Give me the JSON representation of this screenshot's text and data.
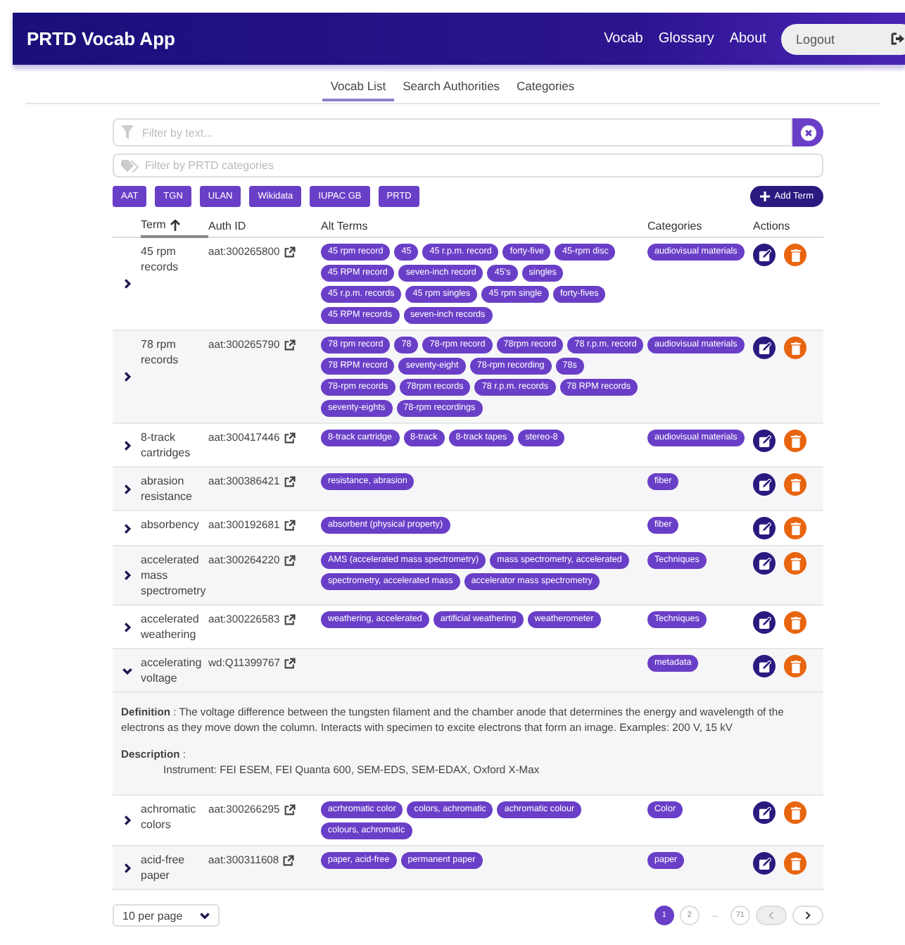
{
  "app_bar": {
    "title": "PRTD Vocab App",
    "nav": [
      "Vocab",
      "Glossary",
      "About"
    ],
    "logout": "Logout"
  },
  "tabs": [
    {
      "label": "Vocab List",
      "selected": true
    },
    {
      "label": "Search Authorities",
      "selected": false
    },
    {
      "label": "Categories",
      "selected": false
    }
  ],
  "text_filter": {
    "placeholder": "Filter by text..."
  },
  "category_filter": {
    "placeholder": "Filter by PRTD categories"
  },
  "sources": [
    "AAT",
    "TGN",
    "ULAN",
    "Wikidata",
    "IUPAC GB",
    "PRTD"
  ],
  "add_button": "Add Term",
  "table": {
    "columns": [
      "Term",
      "Auth ID",
      "Alt Terms",
      "Categories",
      "Actions"
    ],
    "rows": [
      {
        "term": "45 rpm records",
        "auth_id": "aat:300265800",
        "alt_terms": [
          "45 rpm record",
          "45",
          "45 r.p.m. record",
          "forty-five",
          "45-rpm disc",
          "45 RPM record",
          "seven-inch record",
          "45's",
          "singles",
          "45 r.p.m. records",
          "45 rpm singles",
          "45 rpm single",
          "forty-fives",
          "45 RPM records",
          "seven-inch records"
        ],
        "categories": [
          "audiovisual materials"
        ],
        "expanded": false
      },
      {
        "term": "78 rpm records",
        "auth_id": "aat:300265790",
        "alt_terms": [
          "78 rpm record",
          "78",
          "78-rpm record",
          "78rpm record",
          "78 r.p.m. record",
          "78 RPM record",
          "seventy-eight",
          "78-rpm recording",
          "78s",
          "78-rpm records",
          "78rpm records",
          "78 r.p.m. records",
          "78 RPM records",
          "seventy-eights",
          "78-rpm recordings"
        ],
        "categories": [
          "audiovisual materials"
        ],
        "expanded": false
      },
      {
        "term": "8-track cartridges",
        "auth_id": "aat:300417446",
        "alt_terms": [
          "8-track cartridge",
          "8-track",
          "8-track tapes",
          "stereo-8"
        ],
        "categories": [
          "audiovisual materials"
        ],
        "expanded": false
      },
      {
        "term": "abrasion resistance",
        "auth_id": "aat:300386421",
        "alt_terms": [
          "resistance, abrasion"
        ],
        "categories": [
          "fiber"
        ],
        "expanded": false
      },
      {
        "term": "absorbency",
        "auth_id": "aat:300192681",
        "alt_terms": [
          "absorbent (physical property)"
        ],
        "categories": [
          "fiber"
        ],
        "expanded": false
      },
      {
        "term": "accelerated mass spectrometry",
        "auth_id": "aat:300264220",
        "alt_terms": [
          "AMS (accelerated mass spectrometry)",
          "mass spectrometry, accelerated",
          "spectrometry, accelerated mass",
          "accelerator mass spectrometry"
        ],
        "categories": [
          "Techniques"
        ],
        "expanded": false
      },
      {
        "term": "accelerated weathering",
        "auth_id": "aat:300226583",
        "alt_terms": [
          "weathering, accelerated",
          "artificial weathering",
          "weatherometer"
        ],
        "categories": [
          "Techniques"
        ],
        "expanded": false
      },
      {
        "term": "accelerating voltage",
        "auth_id": "wd:Q11399767",
        "alt_terms": [],
        "categories": [
          "metadata"
        ],
        "expanded": true,
        "detail": {
          "definition": "**Definition** : The voltage difference between the tungsten filament and the chamber anode that determines the energy and wavelength of the electrons as they move down the column. Interacts with specimen to excite electrons that form an image. Examples: 200 V, 15 kV",
          "description_label": "**Description** :",
          "description": "Instrument:  FEI ESEM, FEI Quanta 600, SEM-EDS, SEM-EDAX, Oxford X-Max"
        }
      },
      {
        "term": "achromatic colors",
        "auth_id": "aat:300266295",
        "alt_terms": [
          "acrhromatic color",
          "colors, achromatic",
          "achromatic colour",
          "colours, achromatic"
        ],
        "categories": [
          "Color"
        ],
        "expanded": false
      },
      {
        "term": "acid-free paper",
        "auth_id": "aat:300311608",
        "alt_terms": [
          "paper, acid-free",
          "permanent paper"
        ],
        "categories": [
          "paper"
        ],
        "expanded": false
      }
    ]
  },
  "pagination": {
    "page_size": "10 per page",
    "pages": [
      {
        "label": "1",
        "selected": true
      },
      {
        "label": "2",
        "selected": false
      },
      {
        "label": "...",
        "selected": false
      },
      {
        "label": "71",
        "selected": false
      }
    ],
    "prev_disabled": true,
    "next_disabled": false
  }
}
